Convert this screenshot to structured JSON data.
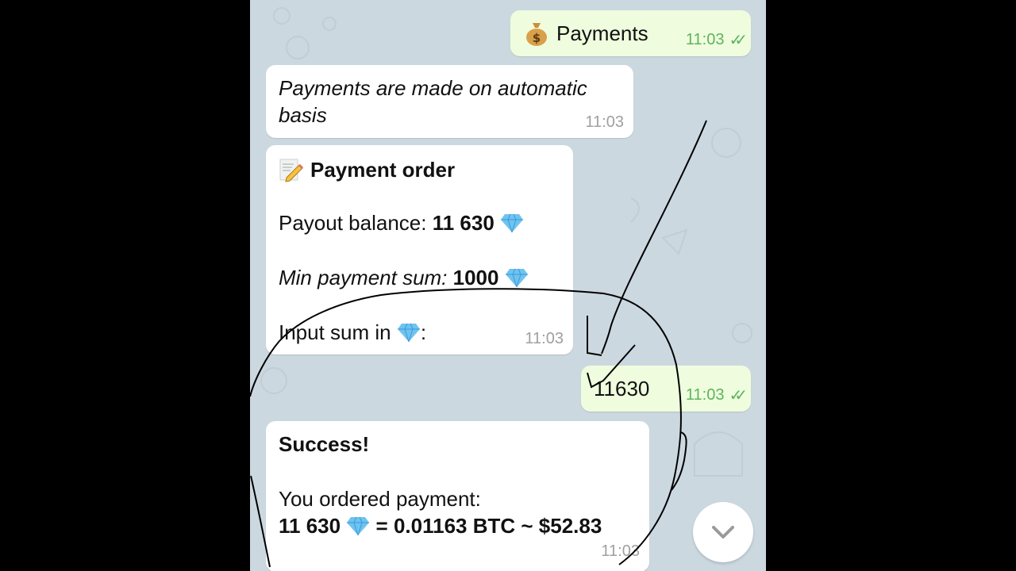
{
  "colors": {
    "chat_background": "#ccd8e0",
    "incoming_bubble": "#ffffff",
    "outgoing_bubble": "#effdde",
    "outgoing_time": "#5fb35f",
    "incoming_time": "#a0a0a0"
  },
  "messages": [
    {
      "direction": "outgoing",
      "icon": "money-bag-icon",
      "text": "Payments",
      "time": "11:03",
      "status": "read-double-check"
    },
    {
      "direction": "incoming",
      "text": "Payments are made on automatic basis",
      "line1": "Payments are made on automatic",
      "line2": "basis",
      "time": "11:03"
    },
    {
      "direction": "incoming",
      "icon": "memo-icon",
      "title": "Payment order",
      "balance_label": "Payout balance: ",
      "balance_value": "11 630",
      "min_label": "Min payment sum:",
      "min_value": " 1000",
      "input_prompt": "Input sum in ",
      "input_suffix": ":",
      "currency_icon": "diamond-icon",
      "time": "11:03"
    },
    {
      "direction": "outgoing",
      "text": "11630",
      "time": "11:03",
      "status": "read-double-check"
    },
    {
      "direction": "incoming",
      "title": "Success!",
      "line1": "You ordered payment:",
      "amount": "11 630",
      "conversion": " = 0.01163 BTC ~ $52.83",
      "time": "11:03"
    }
  ],
  "scroll_down_button": {
    "icon": "chevron-down-icon"
  }
}
